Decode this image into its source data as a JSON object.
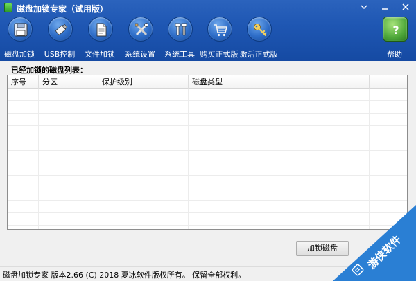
{
  "window": {
    "title": "磁盘加锁专家（试用版）",
    "controls": [
      "menu",
      "minimize",
      "close"
    ]
  },
  "toolbar": {
    "items": [
      {
        "label": "磁盘加锁",
        "icon": "floppy-disk-icon"
      },
      {
        "label": "USB控制",
        "icon": "usb-drive-icon"
      },
      {
        "label": "文件加锁",
        "icon": "document-icon"
      },
      {
        "label": "系统设置",
        "icon": "tools-icon"
      },
      {
        "label": "系统工具",
        "icon": "wrench-icon"
      },
      {
        "label": "购买正式版",
        "icon": "shopping-cart-icon"
      },
      {
        "label": "激活正式版",
        "icon": "key-icon"
      },
      {
        "label": "帮助",
        "icon": "help-icon"
      }
    ]
  },
  "main": {
    "section_title": "已经加锁的磁盘列表：",
    "table": {
      "columns": [
        "序号",
        "分区",
        "保护级别",
        "磁盘类型"
      ],
      "rows": []
    },
    "action_button": "加锁磁盘"
  },
  "status_bar": {
    "text": "磁盘加锁专家  版本2.66 (C)   2018 夏冰软件版权所有。 保留全部权利。"
  },
  "watermark": {
    "text": "游侠软件"
  },
  "colors": {
    "header_blue": "#1f57b3",
    "watermark_blue": "#2a7fd4"
  }
}
